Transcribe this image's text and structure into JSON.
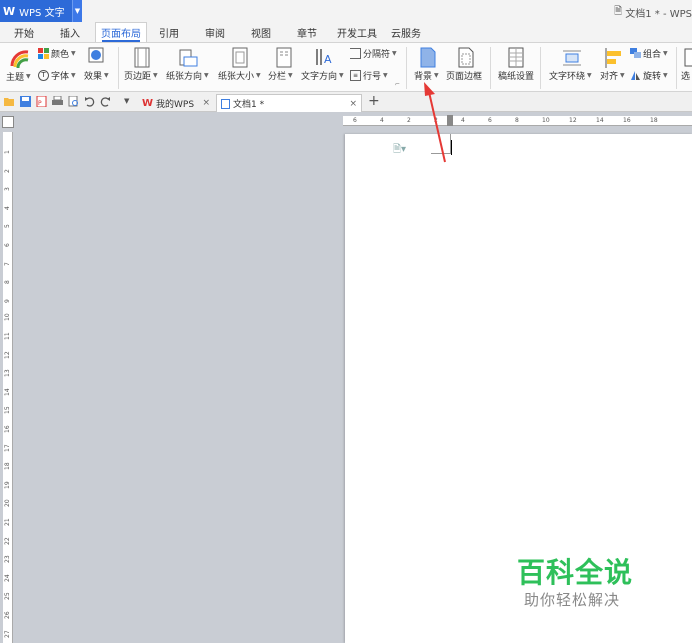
{
  "app": {
    "name": "WPS 文字",
    "doc_title": "文档1 * - WPS"
  },
  "menu_tabs": [
    "开始",
    "插入",
    "页面布局",
    "引用",
    "审阅",
    "视图",
    "章节",
    "开发工具",
    "云服务"
  ],
  "ribbon": {
    "theme": "主题",
    "colors": "颜色",
    "fonts": "字体",
    "effects": "效果",
    "margins": "页边距",
    "orientation": "纸张方向",
    "size": "纸张大小",
    "columns": "分栏",
    "text_direction": "文字方向",
    "breaks": "分隔符",
    "line_numbers": "行号",
    "background": "背景",
    "page_border": "页面边框",
    "grid_paper": "稿纸设置",
    "wrap_text": "文字环绕",
    "align": "对齐",
    "group": "组合",
    "rotate": "旋转",
    "select": "选"
  },
  "doc_tabs": [
    {
      "label": "我的WPS"
    },
    {
      "label": "文档1 *"
    }
  ],
  "ruler_h_labels": [
    "6",
    "4",
    "2",
    "2",
    "4",
    "6",
    "8",
    "10",
    "12",
    "14",
    "16",
    "18"
  ],
  "ruler_v_labels": [
    "1",
    "2",
    "3",
    "4",
    "5",
    "6",
    "7",
    "8",
    "9",
    "10",
    "11",
    "12",
    "13",
    "14",
    "15",
    "16",
    "17",
    "18",
    "19",
    "20",
    "21",
    "22",
    "23",
    "24",
    "25",
    "26",
    "27"
  ],
  "watermark": {
    "title": "百科全说",
    "subtitle": "助你轻松解决"
  },
  "colors": {
    "accent": "#2d6ad8",
    "annotation_arrow": "#e53935",
    "watermark_green": "#2ec05a"
  }
}
